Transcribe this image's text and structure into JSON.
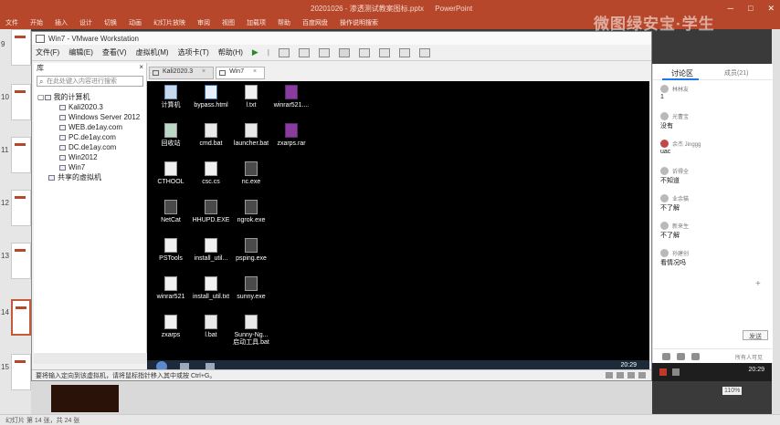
{
  "powerpoint": {
    "title_parts": [
      "20201026 - 渗透测试教案图标.pptx",
      "PowerPoint"
    ],
    "tabs": [
      "文件",
      "开始",
      "插入",
      "设计",
      "切换",
      "动画",
      "幻灯片放映",
      "审阅",
      "视图",
      "加载项",
      "帮助",
      "百度网盘",
      "操作说明搜索"
    ],
    "watermark": "微图绿安宝·学生",
    "slide_numbers": [
      "9",
      "10",
      "11",
      "12",
      "13",
      "14",
      "15"
    ],
    "status_left": "幻灯片 第 14 张，共 24 张",
    "zoom": "110%"
  },
  "vmware": {
    "title": "Win7 - VMware Workstation",
    "menu": [
      "文件(F)",
      "编辑(E)",
      "查看(V)",
      "虚拟机(M)",
      "选项卡(T)",
      "帮助(H)"
    ],
    "library": {
      "header": "库",
      "close": "×",
      "search_placeholder": "在此处键入内容进行搜索",
      "tree": {
        "root": "我的计算机",
        "vms": [
          "Kali2020.3",
          "Windows Server 2012",
          "WEB.de1ay.com",
          "PC.de1ay.com",
          "DC.de1ay.com",
          "Win2012",
          "Win7"
        ],
        "shared": "共享的虚拟机"
      }
    },
    "tabs": [
      {
        "label": "Kali2020.3",
        "close": "×"
      },
      {
        "label": "Win7",
        "close": "×"
      }
    ],
    "desktop_icons": [
      {
        "label": "计算机",
        "kind": "pc"
      },
      {
        "label": "bypass.html",
        "kind": "html"
      },
      {
        "label": "l.txt",
        "kind": "file"
      },
      {
        "label": "winrar521....",
        "kind": "rar"
      },
      {
        "label": "回收站",
        "kind": "bin"
      },
      {
        "label": "cmd.bat",
        "kind": "bat"
      },
      {
        "label": "launcher.bat",
        "kind": "bat"
      },
      {
        "label": "zxarps.rar",
        "kind": "rar"
      },
      {
        "label": "CTHOOL",
        "kind": "file"
      },
      {
        "label": "csc.cs",
        "kind": "file"
      },
      {
        "label": "nc.exe",
        "kind": "exe"
      },
      {
        "label": "NetCat",
        "kind": "exe"
      },
      {
        "label": "HHUPD.EXE",
        "kind": "exe"
      },
      {
        "label": "ngrok.exe",
        "kind": "exe"
      },
      {
        "label": "PSTools",
        "kind": "file"
      },
      {
        "label": "install_util...",
        "kind": "file"
      },
      {
        "label": "psping.exe",
        "kind": "exe"
      },
      {
        "label": "winrar521",
        "kind": "file"
      },
      {
        "label": "install_util.txt",
        "kind": "file"
      },
      {
        "label": "sunny.exe",
        "kind": "exe"
      },
      {
        "label": "zxarps",
        "kind": "file"
      },
      {
        "label": "l.bat",
        "kind": "bat"
      },
      {
        "label": "Sunny-Ng... 启动工具.bat",
        "kind": "bat"
      }
    ],
    "guest_clock": "20:29",
    "status": "要将输入定向到该虚拟机，请将鼠标指针移入其中或按 Ctrl+G。"
  },
  "chat": {
    "tab_active": "讨论区",
    "tab_users": "成员(21)",
    "messages": [
      {
        "name": "林林友",
        "text": "1"
      },
      {
        "name": "光曹宝",
        "text": "没有"
      },
      {
        "name": "余杰 Jinggg",
        "text": "uac"
      },
      {
        "name": "诉得全",
        "text": "不知道"
      },
      {
        "name": "业余猫",
        "text": "不了解"
      },
      {
        "name": "新来生",
        "text": "不了解"
      },
      {
        "name": "孙建创",
        "text": "看情况吗"
      }
    ],
    "send_label": "发送",
    "footer_text": "所有人可见",
    "add": "+"
  },
  "colors": {
    "ppt_red": "#b7472a",
    "vm_bg": "#f0f0f0",
    "desktop": "#000000",
    "accent": "#1d79e6"
  }
}
